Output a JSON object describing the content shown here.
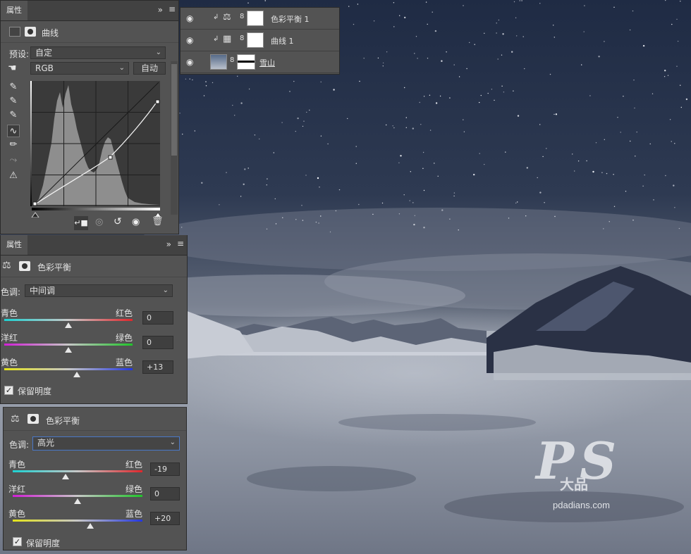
{
  "layers": [
    {
      "name": "色彩平衡 1",
      "type": "color-balance-adjustment"
    },
    {
      "name": "曲线 1",
      "type": "curves-adjustment"
    },
    {
      "name": "雪山",
      "type": "image-layer"
    }
  ],
  "curves_panel": {
    "tab_label": "属性",
    "title": "曲线",
    "preset_label": "预设:",
    "preset_value": "自定",
    "channel_value": "RGB",
    "auto_label": "自动"
  },
  "cb1": {
    "tab_label": "属性",
    "title": "色彩平衡",
    "tone_label": "色调:",
    "tone_value": "中间调",
    "sliders": [
      {
        "left": "青色",
        "right": "红色",
        "value": "0",
        "position": 0.5
      },
      {
        "left": "洋红",
        "right": "绿色",
        "value": "0",
        "position": 0.5
      },
      {
        "left": "黄色",
        "right": "蓝色",
        "value": "+13",
        "position": 0.565
      }
    ],
    "preserve_label": "保留明度",
    "preserve_checked": true
  },
  "cb2": {
    "title": "色彩平衡",
    "tone_label": "色调:",
    "tone_value": "高光",
    "sliders": [
      {
        "left": "青色",
        "right": "红色",
        "value": "-19",
        "position": 0.405
      },
      {
        "left": "洋红",
        "right": "绿色",
        "value": "0",
        "position": 0.5
      },
      {
        "left": "黄色",
        "right": "蓝色",
        "value": "+20",
        "position": 0.6
      }
    ],
    "preserve_label": "保留明度",
    "preserve_checked": true
  },
  "watermark": {
    "site": "pdadians.com",
    "logo_letters": "PS",
    "logo_sub": "大品"
  },
  "colors": {
    "panel": "#535353",
    "panel_dark": "#424242",
    "focus_border": "#4a78c8"
  }
}
